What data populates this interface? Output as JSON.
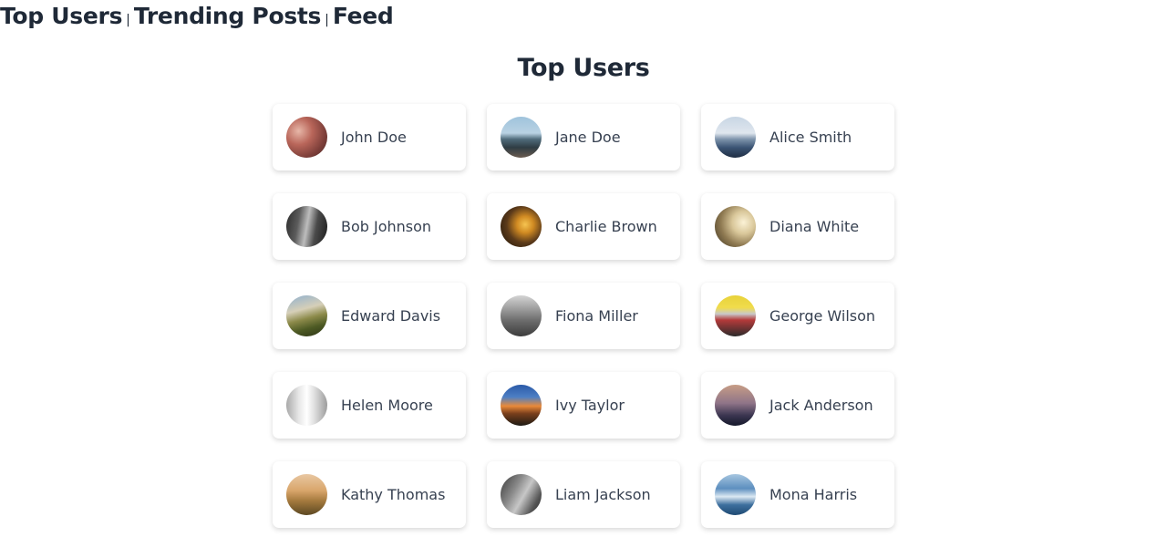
{
  "nav": {
    "links": [
      "Top Users",
      "Trending Posts",
      "Feed"
    ],
    "separator": "|"
  },
  "page": {
    "title": "Top Users"
  },
  "users": [
    {
      "name": "John Doe",
      "avatar": "avatar-photo-street-cafe"
    },
    {
      "name": "Jane Doe",
      "avatar": "avatar-photo-coast"
    },
    {
      "name": "Alice Smith",
      "avatar": "avatar-photo-city"
    },
    {
      "name": "Bob Johnson",
      "avatar": "avatar-photo-bw-street"
    },
    {
      "name": "Charlie Brown",
      "avatar": "avatar-photo-night-lights"
    },
    {
      "name": "Diana White",
      "avatar": "avatar-photo-misty-sun"
    },
    {
      "name": "Edward Davis",
      "avatar": "avatar-photo-mountain"
    },
    {
      "name": "Fiona Miller",
      "avatar": "avatar-photo-van"
    },
    {
      "name": "George Wilson",
      "avatar": "avatar-photo-garage"
    },
    {
      "name": "Helen Moore",
      "avatar": "avatar-photo-snow-forest"
    },
    {
      "name": "Ivy Taylor",
      "avatar": "avatar-photo-sunset-lake"
    },
    {
      "name": "Jack Anderson",
      "avatar": "avatar-photo-silhouette"
    },
    {
      "name": "Kathy Thomas",
      "avatar": "avatar-photo-golden-field"
    },
    {
      "name": "Liam Jackson",
      "avatar": "avatar-photo-interior"
    },
    {
      "name": "Mona Harris",
      "avatar": "avatar-photo-ocean"
    }
  ]
}
